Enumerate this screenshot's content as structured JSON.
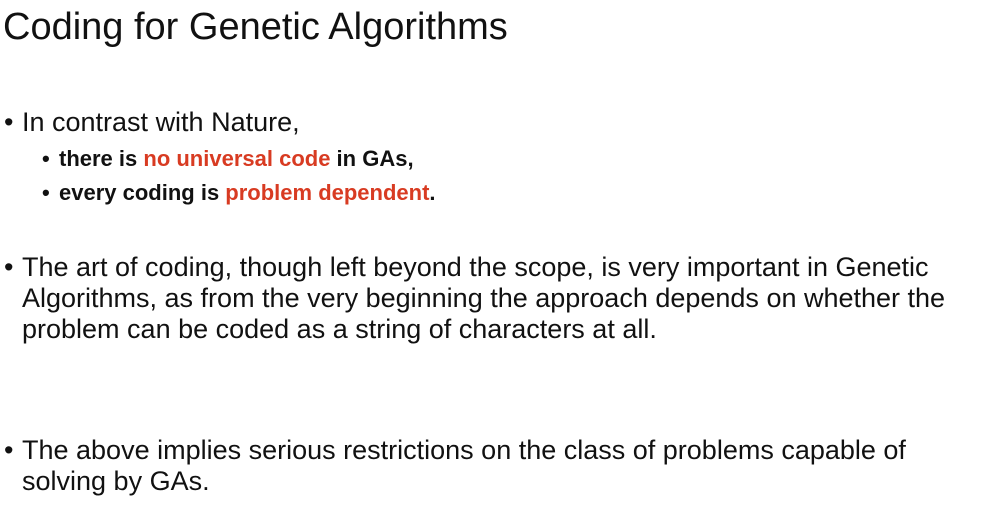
{
  "title": "Coding for Genetic Algorithms",
  "bullet_char": "•",
  "bullets": [
    {
      "text": "In contrast with Nature,",
      "sub": [
        {
          "before": "there is ",
          "highlight": "no universal code",
          "after": " in GAs,"
        },
        {
          "before": "every coding is ",
          "highlight": "problem dependent",
          "after": "."
        }
      ]
    },
    {
      "text": "The art of coding, though left beyond the scope, is very important in Genetic Algorithms, as from the very beginning the approach depends on whether the problem can be coded as a string of characters at all."
    },
    {
      "text": "The above implies serious restrictions on the class of problems capable of solving by GAs."
    }
  ],
  "colors": {
    "text": "#111111",
    "highlight": "#d83b22",
    "background": "#ffffff"
  }
}
